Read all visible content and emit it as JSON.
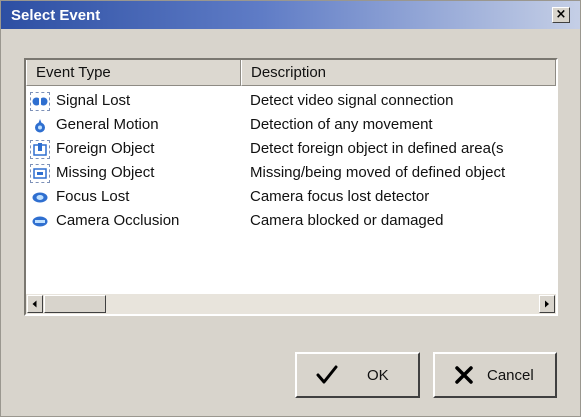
{
  "window": {
    "title": "Select Event",
    "close_label": "×"
  },
  "list": {
    "columns": [
      "Event Type",
      "Description"
    ],
    "rows": [
      {
        "icon": "signal-lost-icon",
        "name": "Signal Lost",
        "description": "Detect video signal connection"
      },
      {
        "icon": "general-motion-icon",
        "name": "General Motion",
        "description": "Detection of any movement"
      },
      {
        "icon": "foreign-object-icon",
        "name": "Foreign Object",
        "description": "Detect foreign object in defined area(s"
      },
      {
        "icon": "missing-object-icon",
        "name": "Missing Object",
        "description": "Missing/being moved of defined object"
      },
      {
        "icon": "focus-lost-icon",
        "name": "Focus Lost",
        "description": "Camera focus lost detector"
      },
      {
        "icon": "camera-occlusion-icon",
        "name": "Camera Occlusion",
        "description": "Camera blocked or damaged"
      }
    ]
  },
  "buttons": {
    "ok_label": "OK",
    "cancel_label": "Cancel"
  },
  "colors": {
    "title_bar_start": "#2d4fa3",
    "icon_blue": "#2f6fd0",
    "dialog_bg": "#d8d4cc"
  }
}
